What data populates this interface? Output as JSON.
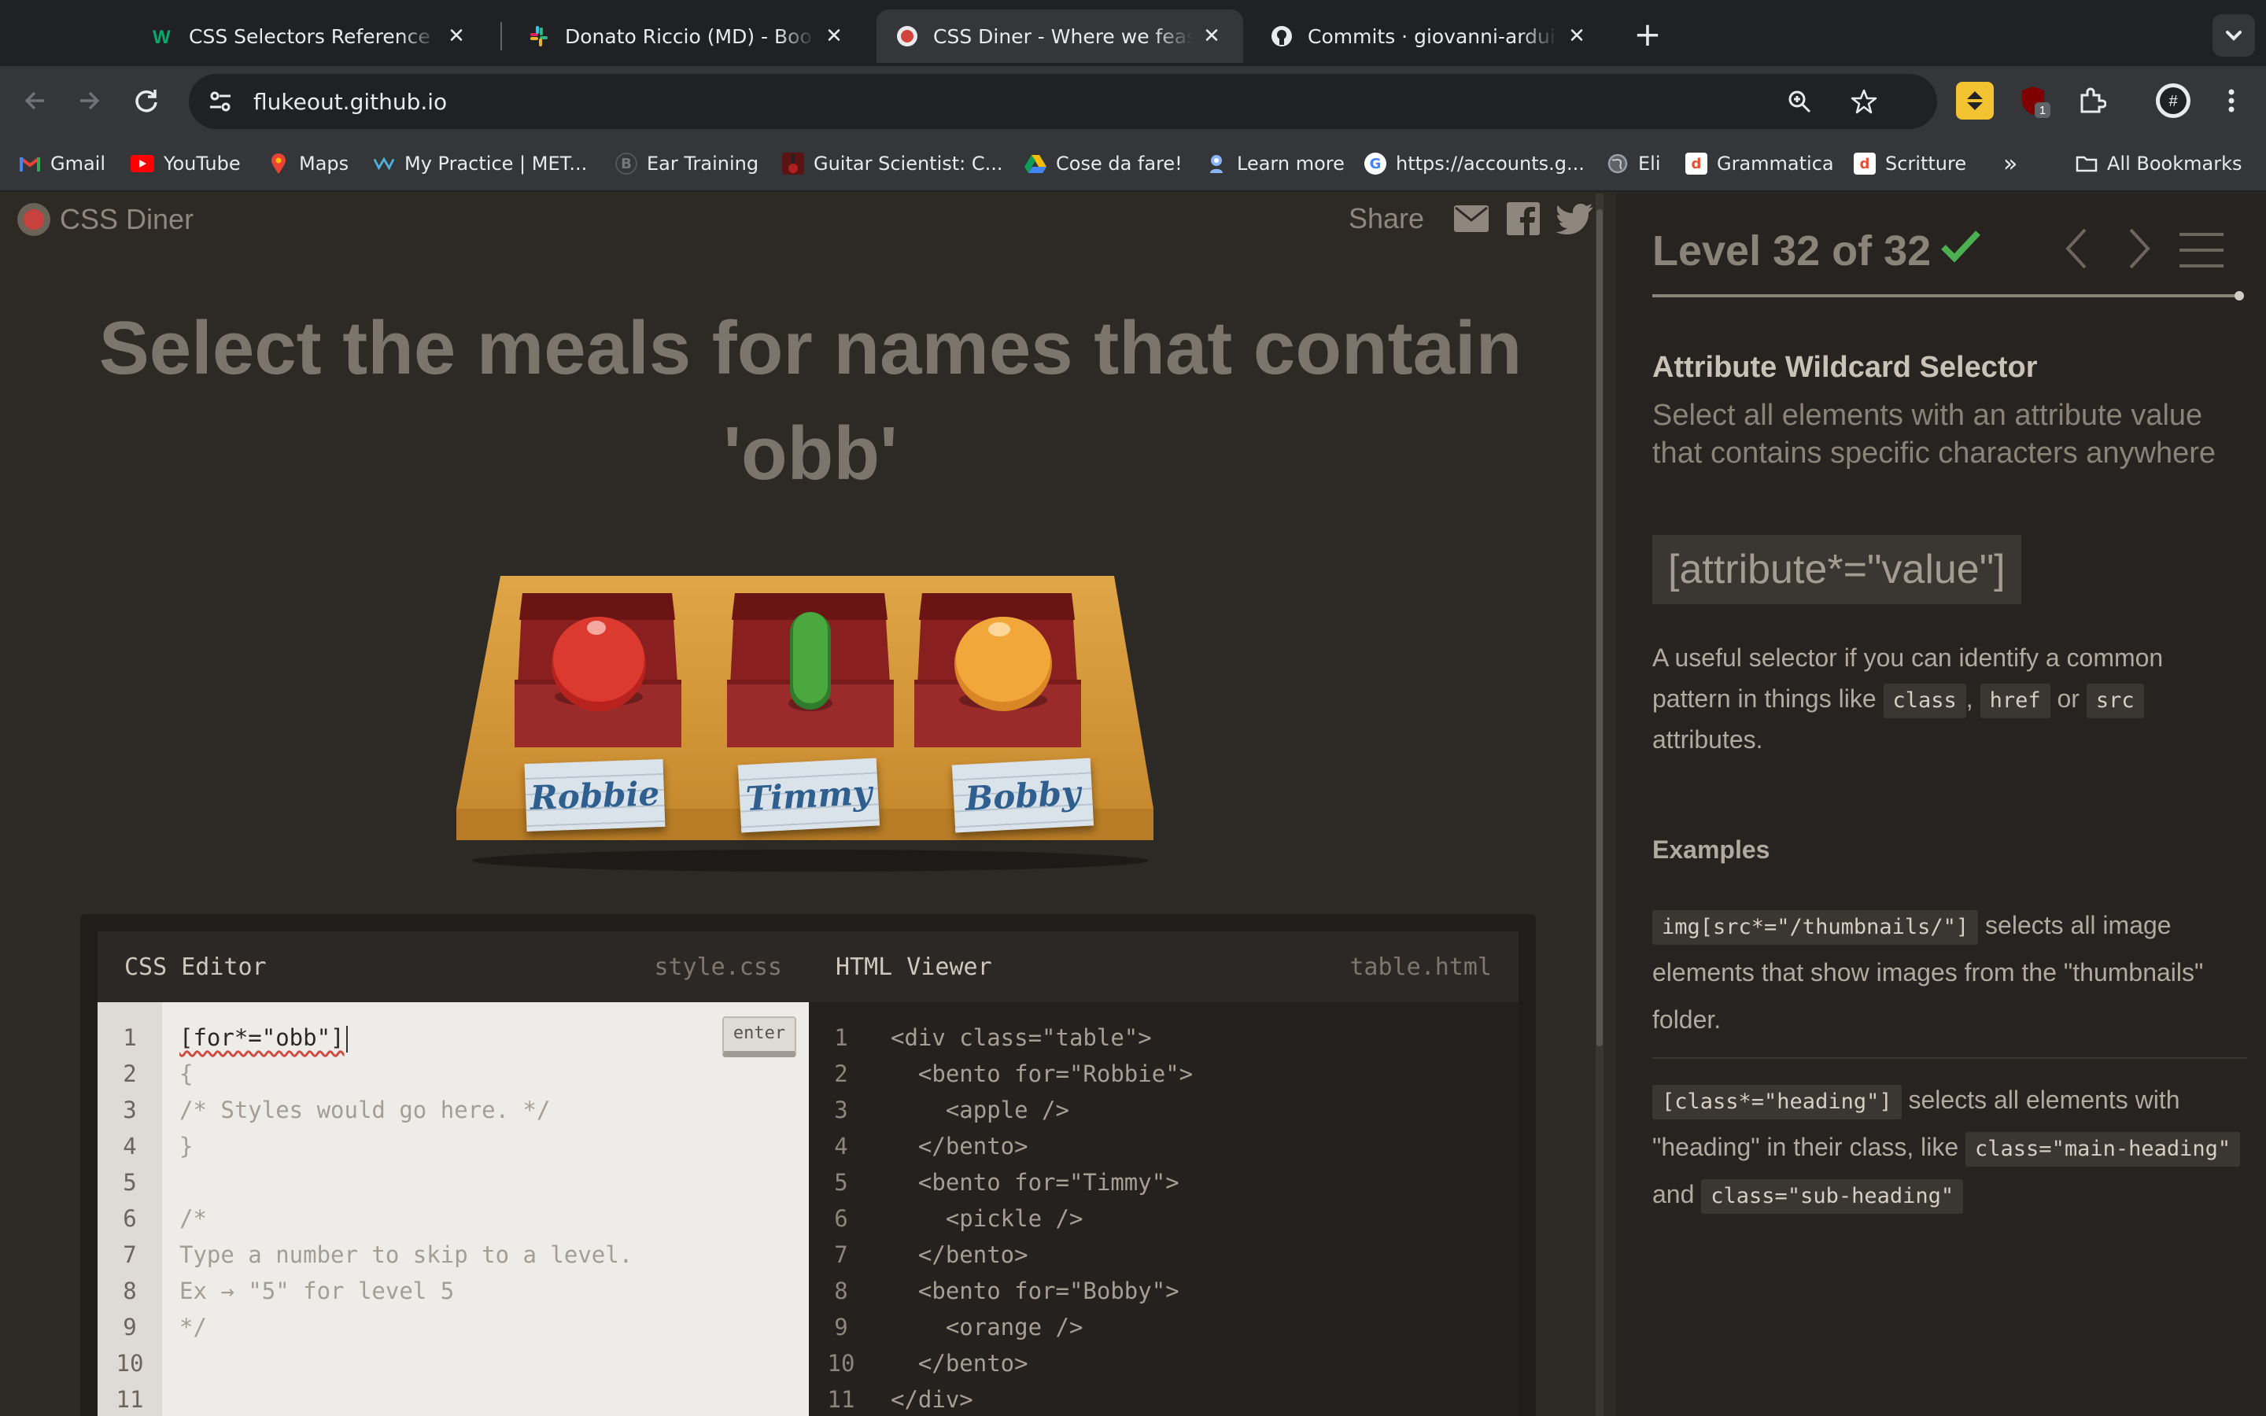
{
  "browser": {
    "tabs": [
      {
        "title": "CSS Selectors Reference",
        "icon": "w3schools-icon"
      },
      {
        "title": "Donato Riccio (MD) - Boolean",
        "icon": "slack-icon"
      },
      {
        "title": "CSS Diner - Where we feast on CSS",
        "icon": "css-diner-icon",
        "active": true
      },
      {
        "title": "Commits · giovanni-arduini/html",
        "icon": "github-icon"
      }
    ],
    "url": "flukeout.github.io",
    "extension_badge": "1",
    "bookmarks": [
      {
        "label": "Gmail"
      },
      {
        "label": "YouTube"
      },
      {
        "label": "Maps"
      },
      {
        "label": "My Practice | MET..."
      },
      {
        "label": "Ear Training"
      },
      {
        "label": "Guitar Scientist: C..."
      },
      {
        "label": "Cose da fare!"
      },
      {
        "label": "Learn more"
      },
      {
        "label": "https://accounts.g..."
      },
      {
        "label": "Eli"
      },
      {
        "label": "Grammatica"
      },
      {
        "label": "Scritture"
      }
    ],
    "all_bookmarks": "All Bookmarks"
  },
  "game": {
    "logo": "CSS Diner",
    "share": "Share",
    "order": "Select the meals for names that contain 'obb'",
    "bentos": [
      {
        "name": "Robbie",
        "food": "apple"
      },
      {
        "name": "Timmy",
        "food": "pickle"
      },
      {
        "name": "Bobby",
        "food": "orange"
      }
    ],
    "css_editor": {
      "title": "CSS Editor",
      "file": "style.css",
      "input": "[for*=\"obb\"]",
      "lines": [
        "{",
        "/* Styles would go here. */",
        "}",
        "",
        "/*",
        "Type a number to skip to a level.",
        "Ex → \"5\" for level 5",
        "*/",
        "",
        ""
      ],
      "line_numbers": [
        "1",
        "2",
        "3",
        "4",
        "5",
        "6",
        "7",
        "8",
        "9",
        "10",
        "11"
      ],
      "enter": "enter"
    },
    "html_viewer": {
      "title": "HTML Viewer",
      "file": "table.html",
      "lines": [
        "<div class=\"table\">",
        "  <bento for=\"Robbie\">",
        "    <apple />",
        "  </bento>",
        "  <bento for=\"Timmy\">",
        "    <pickle />",
        "  </bento>",
        "  <bento for=\"Bobby\">",
        "    <orange />",
        "  </bento>",
        "</div>"
      ],
      "line_numbers": [
        "1",
        "2",
        "3",
        "4",
        "5",
        "6",
        "7",
        "8",
        "9",
        "10",
        "11"
      ]
    }
  },
  "sidebar": {
    "level": "Level 32 of 32",
    "progress": 1.0,
    "selector_name": "Attribute Wildcard Selector",
    "title": "Select all elements with an attribute value that contains specific characters anywhere",
    "syntax": "[attribute*=\"value\"]",
    "hint_pre": "A useful selector if you can identify a common pattern in things like",
    "hint_tags": [
      "class",
      "href",
      "src"
    ],
    "hint_sep1": ",",
    "hint_sep2": "or",
    "hint_post": "attributes.",
    "examples_title": "Examples",
    "examples": [
      {
        "code": "img[src*=\"/thumbnails/\"]",
        "text": "selects all image elements that show images from the \"thumbnails\" folder."
      },
      {
        "code": "[class*=\"heading\"]",
        "text": "selects all elements with \"heading\" in their class, like",
        "code2": "class=\"main-heading\"",
        "and": "and",
        "code3": "class=\"sub-heading\""
      }
    ]
  },
  "colors": {
    "page_bg": "#2d2a26",
    "check": "#4caf50",
    "apple": "#d9322a",
    "pickle": "#3f9a3a",
    "orange": "#f0a63a",
    "bento_wood": "#d69a3c"
  }
}
